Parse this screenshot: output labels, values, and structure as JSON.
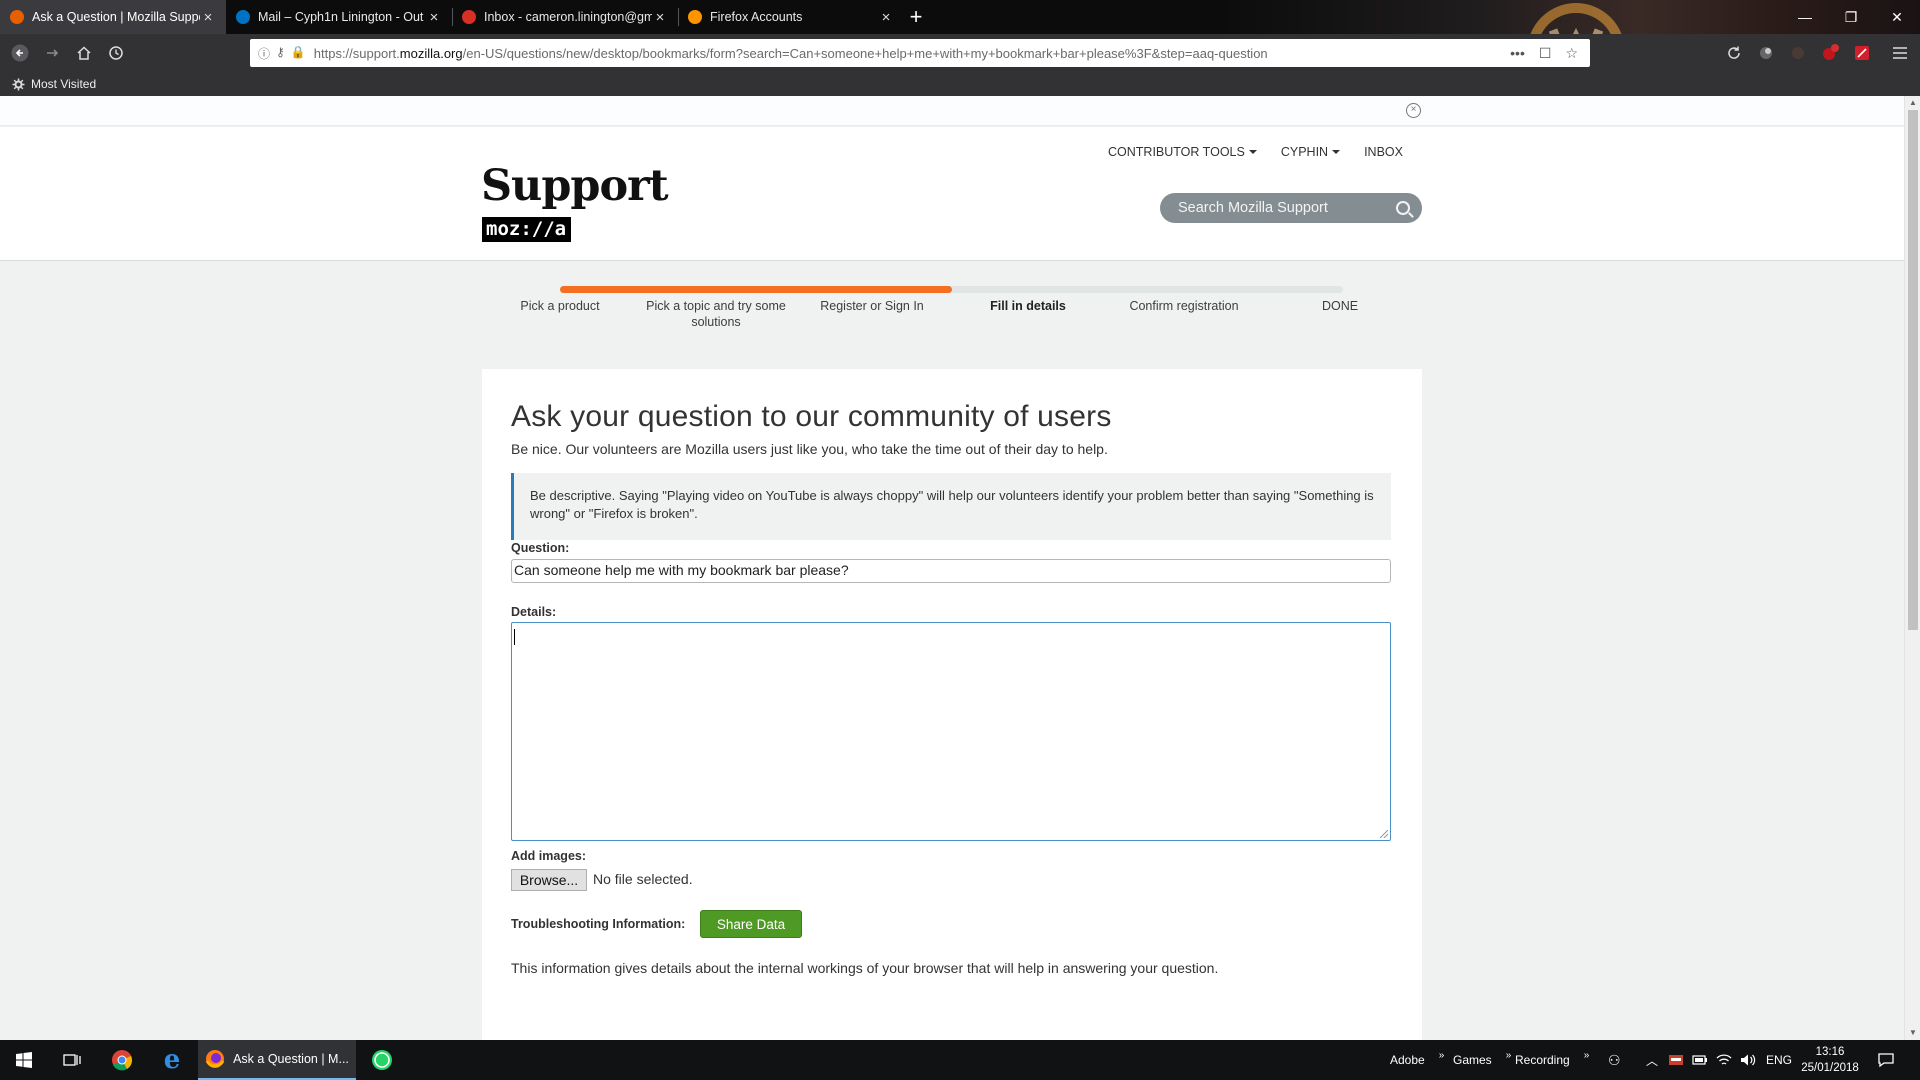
{
  "browser": {
    "tabs": [
      {
        "title": "Ask a Question | Mozilla Suppo",
        "favicon_color": "#e66000",
        "active": true
      },
      {
        "title": "Mail – Cyph1n Linington - Out",
        "favicon_color": "#0072c6",
        "active": false
      },
      {
        "title": "Inbox - cameron.linington@gm",
        "favicon_color": "#d93025",
        "active": false
      },
      {
        "title": "Firefox Accounts",
        "favicon_color": "#ff9400",
        "active": false
      }
    ],
    "new_tab_label": "+",
    "window": {
      "minimize": "—",
      "restore": "❐",
      "close": "✕"
    },
    "url": {
      "prefix": "https://support.",
      "domain": "mozilla.org",
      "path": "/en-US/questions/new/desktop/bookmarks/form?search=Can+someone+help+me+with+my+bookmark+bar+please%3F&step=aaq-question"
    },
    "bookmarks": {
      "most_visited": "Most Visited"
    }
  },
  "site": {
    "top_links": {
      "contributor_tools": "CONTRIBUTOR TOOLS",
      "user": "CYPHIN",
      "inbox": "INBOX"
    },
    "logo_support": "Support",
    "logo_mozilla": "moz://a",
    "search_placeholder": "Search Mozilla Support",
    "notice_close": "×"
  },
  "steps": {
    "progress": 0.5,
    "items": [
      {
        "label": "Pick a product"
      },
      {
        "label": "Pick a topic and try some solutions"
      },
      {
        "label": "Register or Sign In"
      },
      {
        "label": "Fill in details"
      },
      {
        "label": "Confirm registration"
      },
      {
        "label": "DONE"
      }
    ],
    "current_index": 3
  },
  "form": {
    "heading": "Ask your question to our community of users",
    "subtitle": "Be nice. Our volunteers are Mozilla users just like you, who take the time out of their day to help.",
    "hint": "Be descriptive. Saying \"Playing video on YouTube is always choppy\" will help our volunteers identify your problem better than saying \"Something is wrong\" or \"Firefox is broken\".",
    "question_label": "Question:",
    "question_value": "Can someone help me with my bookmark bar please?",
    "details_label": "Details:",
    "details_value": "",
    "add_images_label": "Add images:",
    "browse_label": "Browse...",
    "no_file_text": "No file selected.",
    "troubleshooting_label": "Troubleshooting Information:",
    "share_label": "Share Data",
    "info_text": "This information gives details about the internal workings of your browser that will help in answering your question."
  },
  "taskbar": {
    "active_app_label": "Ask a Question | M...",
    "tray": {
      "adobe": "Adobe",
      "games": "Games",
      "recording": "Recording",
      "language": "ENG"
    },
    "time": "13:16",
    "date": "25/01/2018"
  },
  "colors": {
    "progress": "#f36f21",
    "share_button": "#4f9a24",
    "hint_border": "#2a7ab9"
  }
}
